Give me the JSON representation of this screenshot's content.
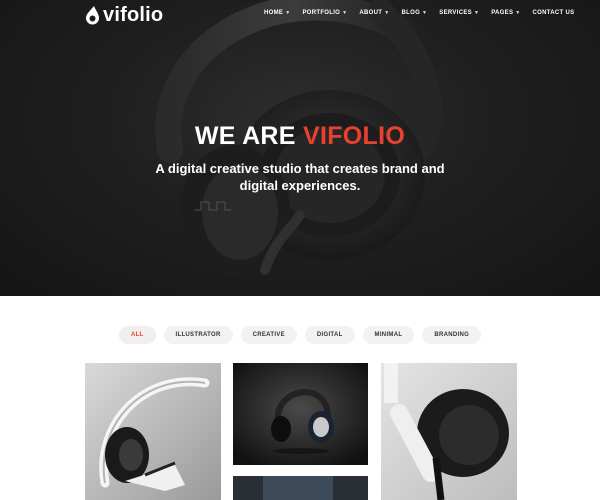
{
  "brand": {
    "name": "vifolio",
    "accent_color": "#e8412e",
    "logo_icon": "drop-logo-icon"
  },
  "nav": {
    "items": [
      {
        "label": "HOME",
        "dropdown": true
      },
      {
        "label": "PORTFOLIO",
        "dropdown": true
      },
      {
        "label": "ABOUT",
        "dropdown": true
      },
      {
        "label": "BLOG",
        "dropdown": true
      },
      {
        "label": "SERVICES",
        "dropdown": true
      },
      {
        "label": "PAGES",
        "dropdown": true
      },
      {
        "label": "CONTACT US",
        "dropdown": false
      }
    ]
  },
  "hero": {
    "title_prefix": "WE ARE",
    "title_accent": "VIFOLIO",
    "subtitle": "A digital creative studio that creates brand and digital experiences."
  },
  "filters": {
    "items": [
      "ALL",
      "ILLUSTRATOR",
      "CREATIVE",
      "DIGITAL",
      "MINIMAL",
      "BRANDING"
    ],
    "active": "ALL"
  },
  "portfolio": {
    "items": [
      {
        "image": "white-headphones-photo"
      },
      {
        "image": "black-headphones-photo"
      },
      {
        "image": "headphone-closeup-photo"
      },
      {
        "image": "dark-headphones-photo"
      }
    ]
  }
}
